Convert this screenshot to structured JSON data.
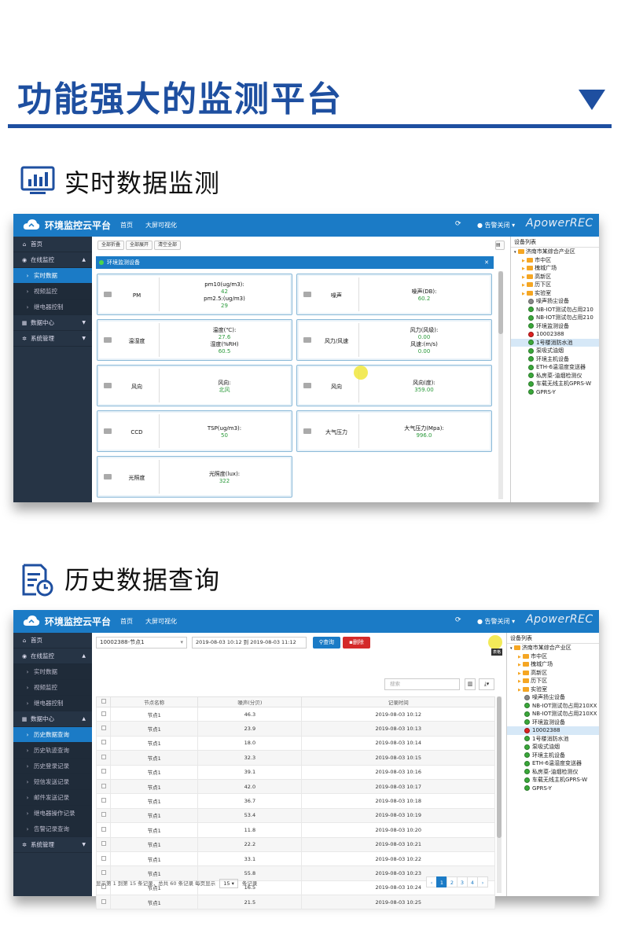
{
  "header": {
    "title": "功能强大的监测平台"
  },
  "section1": {
    "title": "实时数据监测"
  },
  "section2": {
    "title": "历史数据查询"
  },
  "app": {
    "brand": "环境监控云平台",
    "nav": [
      "首页",
      "大屏可视化"
    ],
    "alarm": "告警关闭",
    "watermark": "ApowerREC",
    "accent_color": "#1b7bc6"
  },
  "realtime": {
    "sidebar": [
      {
        "label": "首页",
        "icon": "home-icon",
        "level": 0
      },
      {
        "label": "在线监控",
        "icon": "globe-icon",
        "level": 0,
        "caret": "▲"
      },
      {
        "label": "实时数据",
        "level": 1,
        "active": true
      },
      {
        "label": "视频监控",
        "level": 1
      },
      {
        "label": "继电器控制",
        "level": 1
      },
      {
        "label": "数据中心",
        "icon": "calendar-icon",
        "level": 0,
        "caret": "▼"
      },
      {
        "label": "系统管理",
        "icon": "gear-icon",
        "level": 0,
        "caret": "▼"
      }
    ],
    "toolbar": {
      "btn1": "全部折叠",
      "btn2": "全部展开",
      "btn3": "清空全部"
    },
    "panel_title": "环境监测设备",
    "cards": [
      {
        "name": "PM",
        "lines": [
          {
            "label": "pm10(ug/m3):",
            "value": "42"
          },
          {
            "label": "pm2.5:(ug/m3)",
            "value": "29"
          }
        ]
      },
      {
        "name": "噪声",
        "lines": [
          {
            "label": "噪声(DB):",
            "value": "60.2"
          }
        ]
      },
      {
        "name": "温湿度",
        "lines": [
          {
            "label": "温度(℃):",
            "value": "27.6"
          },
          {
            "label": "湿度(%RH)",
            "value": "60.5"
          }
        ]
      },
      {
        "name": "风力/风速",
        "lines": [
          {
            "label": "风力(风级):",
            "value": "0.00"
          },
          {
            "label": "风速:(m/s)",
            "value": "0.00"
          }
        ]
      },
      {
        "name": "风向",
        "lines": [
          {
            "label": "风向:",
            "value": "北风"
          }
        ]
      },
      {
        "name": "风向",
        "lines": [
          {
            "label": "风向(度):",
            "value": "359.00"
          }
        ]
      },
      {
        "name": "CCD",
        "lines": [
          {
            "label": "TSP(ug/m3):",
            "value": "50"
          }
        ]
      },
      {
        "name": "大气压力",
        "lines": [
          {
            "label": "大气压力(Mpa):",
            "value": "996.0"
          }
        ]
      },
      {
        "name": "光照度",
        "lines": [
          {
            "label": "光照度(lux):",
            "value": "322"
          }
        ]
      }
    ],
    "tree": {
      "title": "设备列表",
      "root": "济南市某综合产业区",
      "folders": [
        "市中区",
        "槐城广场",
        "高新区",
        "历下区",
        "实验室"
      ],
      "devices": [
        {
          "label": "噪声扬尘设备",
          "status": "gray"
        },
        {
          "label": "NB-IOT测试勿占用210",
          "status": "green"
        },
        {
          "label": "NB-IOT测试勿占用210",
          "status": "green"
        },
        {
          "label": "环境监测设备",
          "status": "green"
        },
        {
          "label": "10002388",
          "status": "red"
        },
        {
          "label": "1号楼消防水池",
          "status": "green",
          "selected": true
        },
        {
          "label": "泵吸式油烟",
          "status": "green"
        },
        {
          "label": "环境主机设备",
          "status": "green"
        },
        {
          "label": "ETH-6温湿度变送器",
          "status": "green"
        },
        {
          "label": "私房菜-油烟检测仪",
          "status": "green"
        },
        {
          "label": "车载无线主机GPRS-W",
          "status": "green"
        },
        {
          "label": "GPRS-Y",
          "status": "green"
        }
      ]
    }
  },
  "history": {
    "sidebar": [
      {
        "label": "首页",
        "icon": "home-icon",
        "level": 0
      },
      {
        "label": "在线监控",
        "icon": "globe-icon",
        "level": 0,
        "caret": "▲"
      },
      {
        "label": "实时数据",
        "level": 1
      },
      {
        "label": "视频监控",
        "level": 1
      },
      {
        "label": "继电器控制",
        "level": 1
      },
      {
        "label": "数据中心",
        "icon": "calendar-icon",
        "level": 0,
        "caret": "▲"
      },
      {
        "label": "历史数据查询",
        "level": 1,
        "active": true
      },
      {
        "label": "历史轨迹查询",
        "level": 1
      },
      {
        "label": "历史登录记录",
        "level": 1
      },
      {
        "label": "短信发送记录",
        "level": 1
      },
      {
        "label": "邮件发送记录",
        "level": 1
      },
      {
        "label": "继电器操作记录",
        "level": 1
      },
      {
        "label": "告警记录查询",
        "level": 1
      },
      {
        "label": "系统管理",
        "icon": "gear-icon",
        "level": 0,
        "caret": "▼"
      }
    ],
    "node_select": "10002388-节点1",
    "date_range": "2019-08-03 10:12 到 2019-08-03 11:12",
    "query_btn": "查询",
    "delete_btn": "删除",
    "search_placeholder": "搜索",
    "tooltip": "表格",
    "columns": [
      "节点名称",
      "噪声(分贝)",
      "记录时间"
    ],
    "rows": [
      [
        "节点1",
        "46.3",
        "2019-08-03 10:12"
      ],
      [
        "节点1",
        "23.9",
        "2019-08-03 10:13"
      ],
      [
        "节点1",
        "18.0",
        "2019-08-03 10:14"
      ],
      [
        "节点1",
        "32.3",
        "2019-08-03 10:15"
      ],
      [
        "节点1",
        "39.1",
        "2019-08-03 10:16"
      ],
      [
        "节点1",
        "42.0",
        "2019-08-03 10:17"
      ],
      [
        "节点1",
        "36.7",
        "2019-08-03 10:18"
      ],
      [
        "节点1",
        "53.4",
        "2019-08-03 10:19"
      ],
      [
        "节点1",
        "11.8",
        "2019-08-03 10:20"
      ],
      [
        "节点1",
        "22.2",
        "2019-08-03 10:21"
      ],
      [
        "节点1",
        "33.1",
        "2019-08-03 10:22"
      ],
      [
        "节点1",
        "55.8",
        "2019-08-03 10:23"
      ],
      [
        "节点1",
        "16.5",
        "2019-08-03 10:24"
      ],
      [
        "节点1",
        "21.5",
        "2019-08-03 10:25"
      ]
    ],
    "footer": {
      "info": "显示第 1 到第 15 条记录，总共 60 条记录 每页显示",
      "page_size": "15",
      "suffix": "条记录"
    },
    "pages": [
      "‹",
      "1",
      "2",
      "3",
      "4",
      "›"
    ],
    "tree": {
      "title": "设备列表",
      "root": "济南市某综合产业区",
      "folders": [
        "市中区",
        "槐城广场",
        "高新区",
        "历下区",
        "实验室"
      ],
      "devices": [
        {
          "label": "噪声扬尘设备",
          "status": "gray"
        },
        {
          "label": "NB-IOT测试勿占用210XX",
          "status": "green"
        },
        {
          "label": "NB-IOT测试勿占用210XX",
          "status": "green"
        },
        {
          "label": "环境监测设备",
          "status": "green"
        },
        {
          "label": "10002388",
          "status": "red",
          "selected": true
        },
        {
          "label": "1号楼消防水池",
          "status": "green"
        },
        {
          "label": "泵吸式油烟",
          "status": "green"
        },
        {
          "label": "环境主机设备",
          "status": "green"
        },
        {
          "label": "ETH-6温湿度变送器",
          "status": "green"
        },
        {
          "label": "私房菜-油烟检测仪",
          "status": "green"
        },
        {
          "label": "车载无线主机GPRS-W",
          "status": "green"
        },
        {
          "label": "GPRS-Y",
          "status": "green"
        }
      ]
    }
  }
}
